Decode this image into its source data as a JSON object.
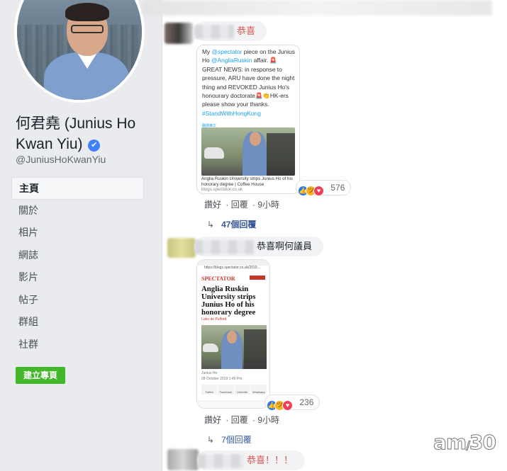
{
  "profile": {
    "name": "何君堯 (Junius Ho Kwan Yiu)",
    "verified_mark": "✔",
    "handle": "@JuniusHoKwanYiu"
  },
  "nav": {
    "items": [
      {
        "label": "主頁",
        "active": true
      },
      {
        "label": "關於"
      },
      {
        "label": "相片"
      },
      {
        "label": "網誌"
      },
      {
        "label": "影片"
      },
      {
        "label": "帖子"
      },
      {
        "label": "群組"
      },
      {
        "label": "社群"
      }
    ],
    "create_page": "建立專頁"
  },
  "comments": [
    {
      "text": "恭喜",
      "text_color": "#d9534f",
      "tweet": {
        "line1": "My ",
        "mention1": "@spectator",
        "line2": " piece on the Junius Ho ",
        "mention2": "@AngliaRuskin",
        "line3": " affair. 🚨 GREAT NEWS: in response to pressure, ARU have done the night thing and REVOKED Junius Ho's honourary doctorate🚨👏HK-ers please show your thanks. ",
        "hashtag": "#StandWithHongKong",
        "translate": "翻譯推文",
        "caption": "Anglia Ruskin University strips Junius Ho of his honorary degree | Coffee House",
        "source": "blogs.spectator.co.uk"
      },
      "reaction_count": "576",
      "actions": {
        "like": "讚好",
        "reply": "回覆",
        "time": "9小時"
      },
      "replies": "47個回覆"
    },
    {
      "text": "恭喜啊何議員",
      "article": {
        "url": "https://blogs.spectator.co.uk/2019...",
        "logo": "SPECTATOR",
        "title": "Anglia Ruskin University strips Junius Ho of his honorary degree",
        "byline": "Lubo de Pulford",
        "caption_small": "Junius Ho",
        "date": "28 October 2019 1:45 Pm",
        "share": [
          "Twitter",
          "Facebook",
          "LinkedIn",
          "Whatsapp"
        ]
      },
      "reaction_count": "236",
      "actions": {
        "like": "讚好",
        "reply": "回覆",
        "time": "9小時"
      },
      "replies": "7個回覆"
    },
    {
      "text": "恭喜！！！",
      "text_color": "#d9534f"
    }
  ],
  "reaction_icons": [
    "like-icon",
    "haha-icon",
    "love-icon"
  ],
  "reply_arrow": "↳",
  "watermark": {
    "brand": "am730"
  }
}
